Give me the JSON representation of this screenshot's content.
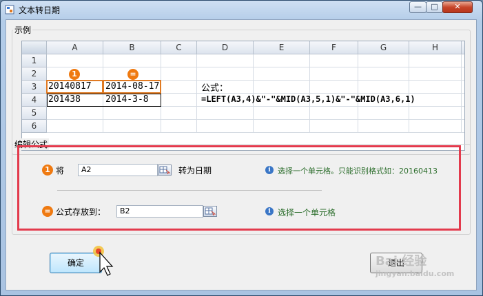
{
  "window": {
    "title": "文本转日期",
    "min_label": "—",
    "max_label": "□",
    "close_label": "✕"
  },
  "example": {
    "group_title": "示例",
    "columns": [
      "A",
      "B",
      "C",
      "D",
      "E",
      "F",
      "G",
      "H"
    ],
    "rows": [
      "1",
      "2",
      "3",
      "4",
      "5",
      "6"
    ],
    "badge1": "1",
    "badge2": "=",
    "a3": "20140817",
    "b3": "2014-08-17",
    "a4": "201438",
    "b4": "2014-3-8",
    "formula_label": "公式：",
    "formula": "=LEFT(A3,4)&\"-\"&MID(A3,5,1)&\"-\"&MID(A3,6,1)"
  },
  "edit": {
    "group_title": "编辑公式",
    "row1": {
      "badge": "1",
      "prefix": "将",
      "value": "A2",
      "suffix": "转为日期",
      "info_icon": "i",
      "hint": "选择一个单元格。只能识别格式如：20160413"
    },
    "row2": {
      "badge": "=",
      "label": "公式存放到：",
      "value": "B2",
      "info_icon": "i",
      "hint": "选择一个单元格"
    }
  },
  "buttons": {
    "ok": "确定",
    "exit": "退出"
  },
  "watermark": "Bai 经验",
  "watermark_url": "jingyan.baidu.com"
}
